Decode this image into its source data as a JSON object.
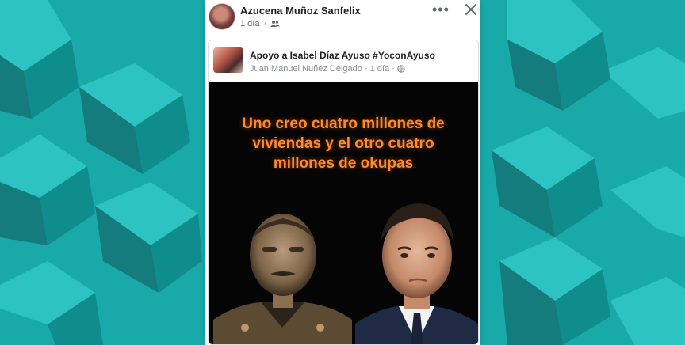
{
  "post": {
    "author": "Azucena Muñoz Sanfelix",
    "time": "1 día",
    "separator": "·",
    "audience_icon": "friends-icon",
    "menu_icon": "more-dots-icon",
    "close_icon": "close-icon"
  },
  "shared": {
    "group_name": "Apoyo a Isabel Díaz Ayuso #YoconAyuso",
    "poster": "Juan Manuel Nuñez Delgado",
    "time": "1 día",
    "separator": "·",
    "audience_icon": "globe-icon"
  },
  "image": {
    "headline_lines": [
      "Uno creo cuatro millones de",
      "viviendas y el otro cuatro",
      "millones de okupas"
    ],
    "headline_color": "#ff8a2a",
    "background_color": "#050505"
  },
  "colors": {
    "page_background": "#17a3a3",
    "card_background": "#ffffff"
  }
}
